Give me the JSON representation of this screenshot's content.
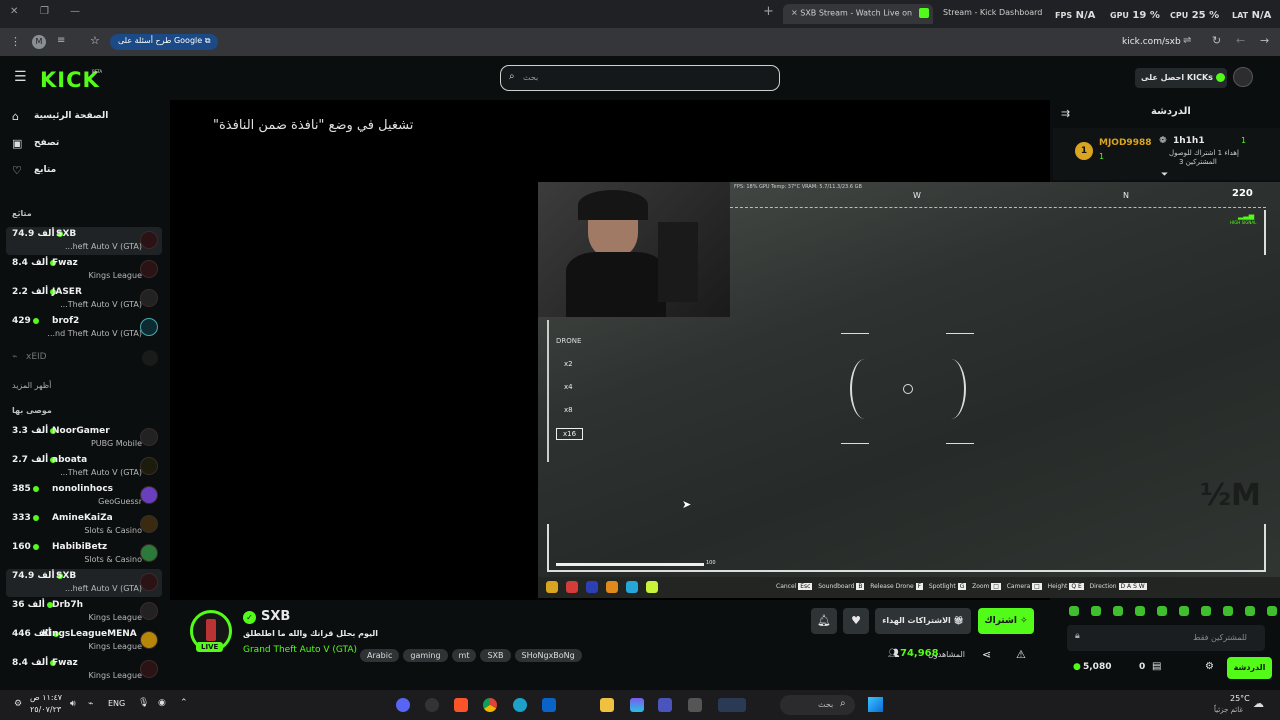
{
  "browser": {
    "tabs": [
      {
        "title": "SXB Stream - Watch Live on",
        "active": true
      },
      {
        "title": "Stream - Kick Dashboard",
        "active": false
      }
    ],
    "hud": {
      "fps_label": "FPS",
      "fps_value": "N/A",
      "gpu_label": "GPU",
      "gpu_value": "19 %",
      "cpu_label": "CPU",
      "cpu_value": "25 %",
      "lat_label": "LAT",
      "lat_value": "N/A"
    },
    "profile_initial": "M",
    "google_chip": "طرح أسئلة على Google",
    "url": "kick.com/sxb"
  },
  "header": {
    "logo": "KICK",
    "logo_beta": "BETA",
    "search_placeholder": "بحث",
    "get_kicks": "احصل على KICKs"
  },
  "sidebar": {
    "nav": [
      {
        "label": "الصفحة الرئيسية",
        "icon": "home-icon"
      },
      {
        "label": "تصفح",
        "icon": "browse-icon"
      },
      {
        "label": "متابع",
        "icon": "heart-icon"
      }
    ],
    "following_title": "متابَع",
    "following": [
      {
        "name": "SXB",
        "viewers": "74.9 ألف",
        "game": "...heft Auto V (GTA)",
        "highlight": true
      },
      {
        "name": "Fwaz",
        "viewers": "8.4 ألف",
        "game": "Kings League"
      },
      {
        "name": "JASER",
        "viewers": "2.2 ألف",
        "game": "...Theft Auto V (GTA)"
      },
      {
        "name": "brof2",
        "viewers": "429",
        "game": "...nd Theft Auto V (GTA)"
      }
    ],
    "offline_name": "xEID",
    "show_more": "أظهر المزيد",
    "recommended_title": "موصى بها",
    "recommended": [
      {
        "name": "NoorGamer",
        "viewers": "3.3 ألف",
        "game": "PUBG Mobile"
      },
      {
        "name": "aboata",
        "viewers": "2.7 ألف",
        "game": "...Theft Auto V (GTA)"
      },
      {
        "name": "nonolinhocs",
        "viewers": "385",
        "game": "GeoGuessr"
      },
      {
        "name": "AmineKaiZa",
        "viewers": "333",
        "game": "Slots & Casino"
      },
      {
        "name": "HabibiBetz",
        "viewers": "160",
        "game": "Slots & Casino"
      },
      {
        "name": "SXB",
        "viewers": "74.9 ألف",
        "game": "...heft Auto V (GTA)",
        "highlight": true
      },
      {
        "name": "Drb7h",
        "viewers": "36 ألف",
        "game": "Kings League"
      },
      {
        "name": "KingsLeagueMENA",
        "viewers": "446 ألف",
        "game": "Kings League"
      },
      {
        "name": "Fwaz",
        "viewers": "8.4 ألف",
        "game": "Kings League"
      }
    ]
  },
  "player": {
    "pip_message": "\"تشغيل في وضع \"نافذة ضمن النافذة",
    "hud_top": "FPS: 18%    GPU Temp: 37°C  VRAM: 5.7/11.3/23.6 GB",
    "compass_w": "W",
    "compass_n": "N",
    "altitude": "220",
    "signal": "HIGH SIGNAL",
    "drone_label": "DRONE",
    "zoom_levels": [
      "x2",
      "x4",
      "x8",
      "x16"
    ],
    "selected_zoom": "x16",
    "distance": "½M",
    "bar_value": "100",
    "controls": [
      {
        "label": "Cancel",
        "key": "Esc"
      },
      {
        "label": "Soundboard",
        "key": "B"
      },
      {
        "label": "Release Drone",
        "key": "F"
      },
      {
        "label": "Spotlight",
        "key": "G"
      },
      {
        "label": "Zoom",
        "key": "□"
      },
      {
        "label": "Camera",
        "key": "□"
      },
      {
        "label": "Height",
        "key": "Q E"
      },
      {
        "label": "Direction",
        "key": "D A S W"
      }
    ]
  },
  "chat": {
    "title": "الدردشة",
    "users": [
      {
        "name": "MJOD9988",
        "rank": "1"
      },
      {
        "name": "1h1h1",
        "rank": "1"
      }
    ],
    "gift_message": "إهداء 1 اشتراك للوصول",
    "gift_sub": "المشتركين 3",
    "input_placeholder": "للمشتركين فقط",
    "points": "5,080",
    "cart_count": "0",
    "chat_button": "الدردشة"
  },
  "stream_info": {
    "channel": "SXB",
    "live": "LIVE",
    "title": "اليوم بحلل قرانك والله ما اطلطلق",
    "game": "Grand Theft Auto V (GTA)",
    "tags": [
      "Arabic",
      "gaming",
      "mt",
      "SXB",
      "SHoNgxBoNg"
    ],
    "subscribe": "اشتراك",
    "gift_subs": "الاشتراكات الهداء",
    "viewers_label": "المشاهدون",
    "viewers": "74,968"
  },
  "taskbar": {
    "time": "١١:٤٧ ص",
    "date": "٢٥/٠٧/٢٣",
    "lang": "ENG",
    "search": "بحث",
    "weather_temp": "25°C",
    "weather_desc": "غائم جزئياً"
  }
}
